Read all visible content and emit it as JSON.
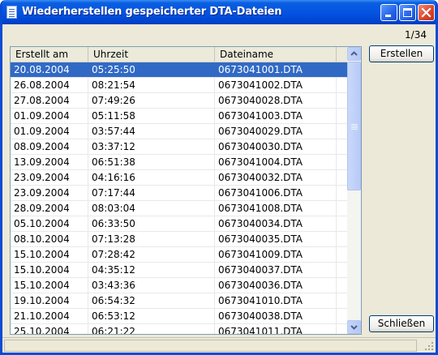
{
  "window": {
    "title": "Wiederherstellen gespeicherter DTA-Dateien",
    "counter": "1/34"
  },
  "list": {
    "columns": [
      "Erstellt am",
      "Uhrzeit",
      "Dateiname"
    ],
    "selected_index": 0,
    "rows": [
      [
        "20.08.2004",
        "05:25:50",
        "0673041001.DTA"
      ],
      [
        "26.08.2004",
        "08:21:54",
        "0673041002.DTA"
      ],
      [
        "27.08.2004",
        "07:49:26",
        "0673040028.DTA"
      ],
      [
        "01.09.2004",
        "05:11:58",
        "0673041003.DTA"
      ],
      [
        "01.09.2004",
        "03:57:44",
        "0673040029.DTA"
      ],
      [
        "08.09.2004",
        "03:37:12",
        "0673040030.DTA"
      ],
      [
        "13.09.2004",
        "06:51:38",
        "0673041004.DTA"
      ],
      [
        "23.09.2004",
        "04:16:16",
        "0673040032.DTA"
      ],
      [
        "23.09.2004",
        "07:17:44",
        "0673041006.DTA"
      ],
      [
        "28.09.2004",
        "08:03:04",
        "0673041008.DTA"
      ],
      [
        "05.10.2004",
        "06:33:50",
        "0673040034.DTA"
      ],
      [
        "08.10.2004",
        "07:13:28",
        "0673040035.DTA"
      ],
      [
        "15.10.2004",
        "07:28:42",
        "0673041009.DTA"
      ],
      [
        "15.10.2004",
        "04:35:12",
        "0673040037.DTA"
      ],
      [
        "15.10.2004",
        "03:43:36",
        "0673040036.DTA"
      ],
      [
        "19.10.2004",
        "06:54:32",
        "0673041010.DTA"
      ],
      [
        "21.10.2004",
        "06:53:12",
        "0673040038.DTA"
      ],
      [
        "25.10.2004",
        "06:21:22",
        "0673041011.DTA"
      ]
    ]
  },
  "buttons": {
    "create": "Erstellen",
    "close": "Schließen"
  },
  "colors": {
    "titlebar": "#0554e3",
    "selection": "#316ac5",
    "close_button": "#d9442a"
  },
  "icons": [
    "app-icon",
    "minimize-icon",
    "maximize-icon",
    "close-icon",
    "scroll-up-icon",
    "scroll-down-icon",
    "resize-grip-icon"
  ]
}
